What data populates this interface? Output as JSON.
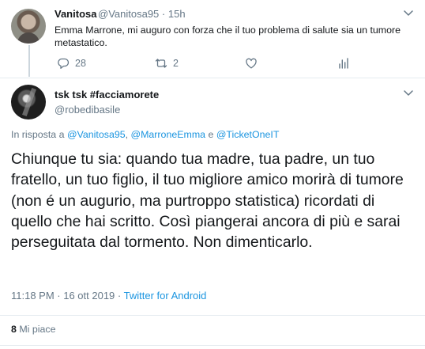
{
  "reply_tweet": {
    "display_name": "Vanitosa",
    "handle": "@Vanitosa95",
    "separator": "·",
    "time": "15h",
    "text": "Emma Marrone, mi auguro con forza che il tuo problema di salute sia un tumore metastatico.",
    "replies": "28",
    "retweets": "2",
    "likes": ""
  },
  "main_tweet": {
    "display_name": "tsk tsk #facciamorete",
    "handle": "@robedibasile",
    "reply_prefix": "In risposta a ",
    "mentions": [
      "@Vanitosa95",
      "@MarroneEmma",
      "@TicketOneIT"
    ],
    "sep_comma": ", ",
    "sep_and": " e ",
    "text": "Chiunque tu sia: quando tua madre, tua padre, un tuo fratello, un tuo figlio, il tuo migliore amico morirà di tumore (non é un augurio, ma purtroppo statistica) ricordati di quello che hai scritto. Così piangerai ancora di più e sarai perseguitata dal tormento. Non dimenticarlo.",
    "timestamp": "11:18 PM · 16 ott 2019 · ",
    "source": "Twitter for Android",
    "like_count": "8",
    "like_label": " Mi piace"
  },
  "colors": {
    "link": "#1b95e0",
    "secondary": "#657786",
    "divider": "#e6ecf0"
  }
}
